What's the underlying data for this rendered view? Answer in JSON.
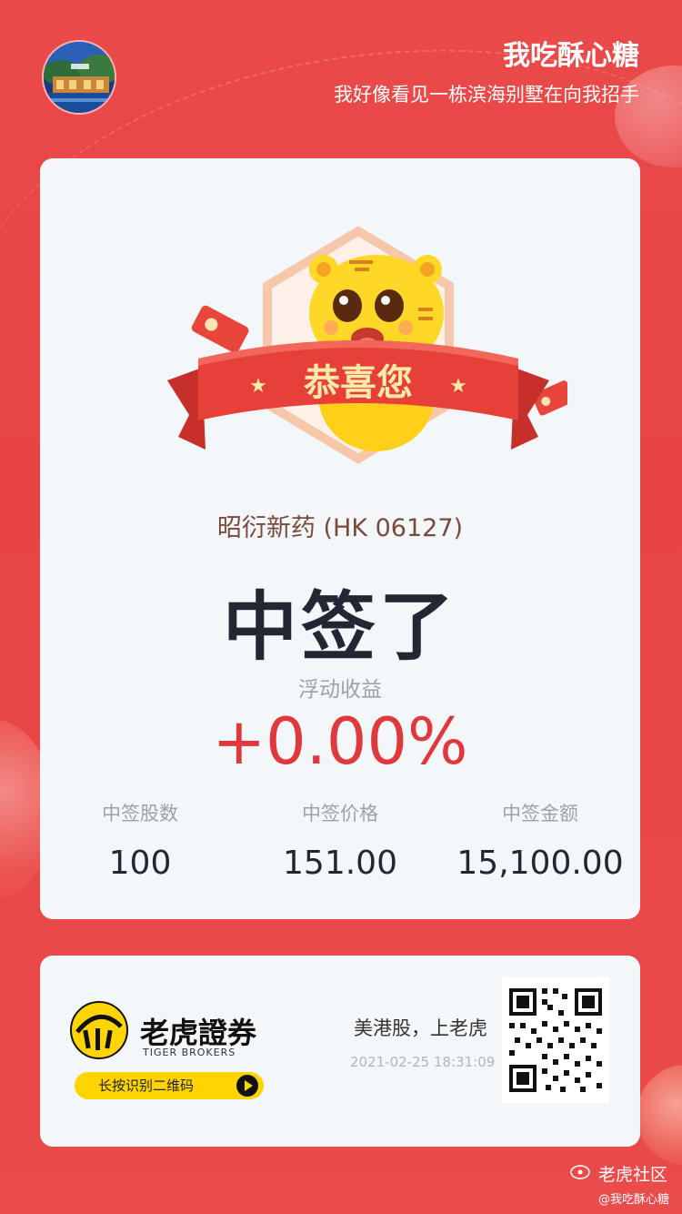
{
  "header": {
    "user_name": "我吃酥心糖",
    "tagline": "我好像看见一栋滨海别墅在向我招手"
  },
  "card": {
    "banner_text": "恭喜您",
    "stock_name": "昭衍新药 (HK 06127)",
    "status": "中签了",
    "float_label": "浮动收益",
    "float_value": "+0.00%",
    "stats": [
      {
        "label": "中签股数",
        "value": "100"
      },
      {
        "label": "中签价格",
        "value": "151.00"
      },
      {
        "label": "中签金额",
        "value": "15,100.00"
      }
    ]
  },
  "promo": {
    "brand_name": "老虎證券",
    "brand_sub": "TIGER BROKERS",
    "scan_label": "长按识别二维码",
    "slogan": "美港股，上老虎",
    "timestamp": "2021-02-25 18:31:09"
  },
  "watermark": {
    "community": "老虎社区",
    "user": "@我吃酥心糖"
  },
  "colors": {
    "background": "#e84444",
    "card": "#f4f7f9",
    "profit": "#e1383c",
    "brand_yellow": "#ffd400"
  }
}
